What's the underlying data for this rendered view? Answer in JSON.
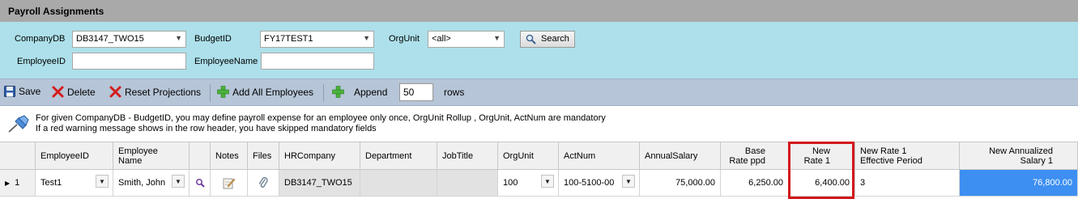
{
  "title": "Payroll Assignments",
  "filters": {
    "company_db_label": "CompanyDB",
    "company_db_value": "DB3147_TWO15",
    "budget_id_label": "BudgetID",
    "budget_id_value": "FY17TEST1",
    "org_unit_label": "OrgUnit",
    "org_unit_value": "<all>",
    "search_label": "Search",
    "employee_id_label": "EmployeeID",
    "employee_id_value": "",
    "employee_name_label": "EmployeeName",
    "employee_name_value": ""
  },
  "toolbar": {
    "save": "Save",
    "delete": "Delete",
    "reset": "Reset Projections",
    "add_all": "Add All Employees",
    "append": "Append",
    "rows_value": "50",
    "rows_label": "rows"
  },
  "info": {
    "line1": "For given CompanyDB - BudgetID, you may define payroll expense for an employee only once, OrgUnit Rollup , OrgUnit, ActNum are mandatory",
    "line2": "If a red warning message shows in the row header, you have skipped mandatory fields"
  },
  "grid": {
    "headers": {
      "employee_id": "EmployeeID",
      "employee_name_1": "Employee",
      "employee_name_2": "Name",
      "notes": "Notes",
      "files": "Files",
      "hr_company": "HRCompany",
      "department": "Department",
      "job_title": "JobTitle",
      "org_unit": "OrgUnit",
      "act_num": "ActNum",
      "annual_salary": "AnnualSalary",
      "base_rate_1": "Base",
      "base_rate_2": "Rate ppd",
      "new_rate_1a": "New",
      "new_rate_1b": "Rate 1",
      "new_rate_eff_1": "New Rate 1",
      "new_rate_eff_2": "Effective Period",
      "new_annual_1": "New Annualized",
      "new_annual_2": "Salary 1"
    },
    "row": {
      "row_num": "1",
      "employee_id": "Test1",
      "employee_name": "Smith, John",
      "hr_company": "DB3147_TWO15",
      "department": "",
      "job_title": "",
      "org_unit": "100",
      "act_num": "100-5100-00",
      "annual_salary": "75,000.00",
      "base_rate": "6,250.00",
      "new_rate": "6,400.00",
      "effective_period": "3",
      "new_annualized": "76,800.00"
    }
  },
  "colors": {
    "filter_bg": "#ade0ea",
    "toolbar_bg": "#b6c5d7",
    "selected_cell": "#3d8ff2",
    "highlight_border": "#d3171c"
  }
}
